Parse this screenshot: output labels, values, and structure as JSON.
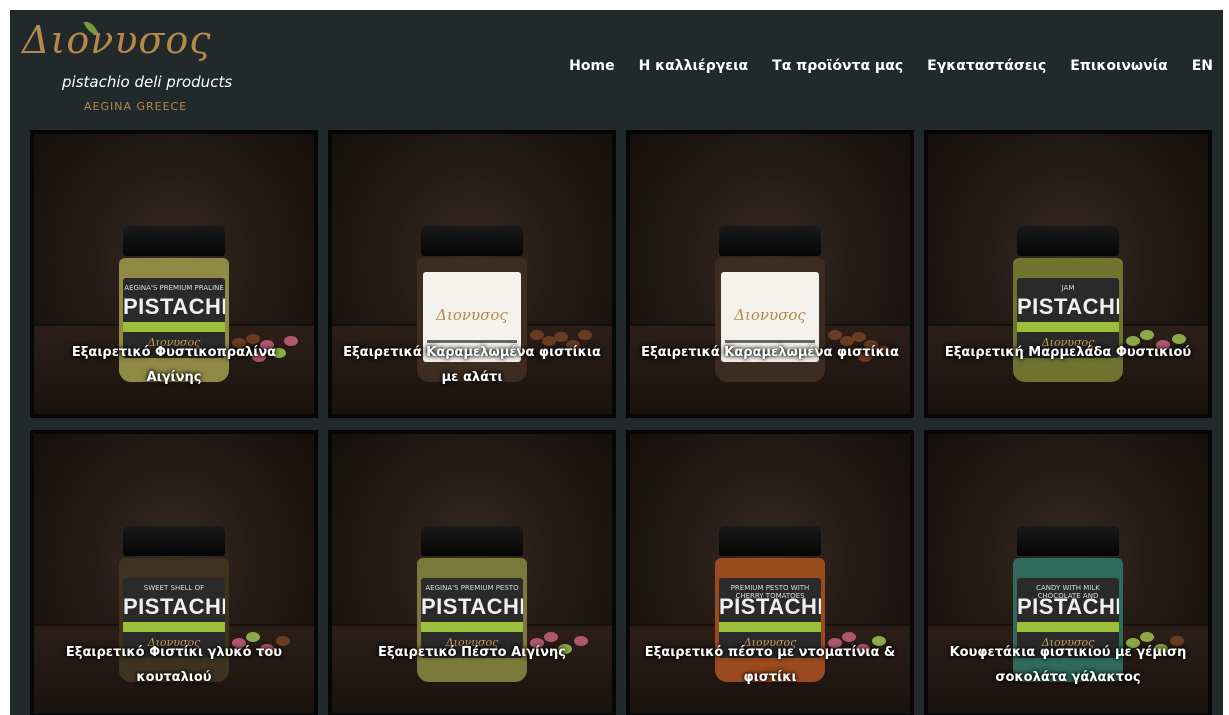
{
  "brand": {
    "name": "Διονυσος",
    "tagline": "pistachio deli products",
    "location": "AEGINA GREECE",
    "colors": {
      "gold": "#b5894a",
      "leaf": "#7a9b3a",
      "background": "#22292a"
    }
  },
  "nav": {
    "items": [
      {
        "label": "Home"
      },
      {
        "label": "Η καλλιέργεια"
      },
      {
        "label": "Τα προϊόντα μας"
      },
      {
        "label": "Εγκαταστάσεις"
      },
      {
        "label": "Επικοινωνία"
      },
      {
        "label": "EN"
      }
    ]
  },
  "products": [
    {
      "caption": "Εξαιρετικό Φυστικοπραλίνα Αιγίνης",
      "jar_style": "dark",
      "glass_color": "#8f8a45",
      "label_top": "AEGINA'S PREMIUM PRALINE",
      "label_main": "PISTACHIO",
      "label_brand": "Διονυσος"
    },
    {
      "caption": "Εξαιρετικά Καραμελωμένα φιστίκια με αλάτι",
      "jar_style": "white",
      "glass_color": "#3d2c22",
      "label_brand": "Διονυσος"
    },
    {
      "caption": "Εξαιρετικά Καραμελωμένα φιστίκια",
      "jar_style": "white",
      "glass_color": "#3d2c22",
      "label_brand": "Διονυσος"
    },
    {
      "caption": "Εξαιρετική Μαρμελάδα Φυστικιού",
      "jar_style": "dark",
      "glass_color": "#6e7330",
      "label_top": "JAM",
      "label_main": "PISTACHIO",
      "label_brand": "Διονυσος"
    },
    {
      "caption": "Εξαιρετικό Φιστίκι γλυκό του κουταλιού",
      "jar_style": "dark",
      "glass_color": "#3f3320",
      "label_top": "SWEET SHELL OF",
      "label_main": "PISTACHIO",
      "label_brand": "Διονυσος"
    },
    {
      "caption": "Εξαιρετικό Πέστο Αιγίνης",
      "jar_style": "dark",
      "glass_color": "#7b7a3a",
      "label_top": "AEGINA'S PREMIUM PESTO",
      "label_main": "PISTACHIO",
      "label_brand": "Διονυσος"
    },
    {
      "caption": "Εξαιρετικό πέστο με ντοματίνια & φιστίκι",
      "jar_style": "dark",
      "glass_color": "#9a4a1e",
      "label_top": "PREMIUM PESTO WITH CHERRY TOMATOES",
      "label_main": "PISTACHIO",
      "label_brand": "Διονυσος"
    },
    {
      "caption": "Κουφετάκια φιστικιού με γέμιση σοκολάτα γάλακτος",
      "jar_style": "dark",
      "glass_color": "#2f6a5a",
      "label_top": "CANDY WITH MILK CHOCOLATE AND",
      "label_main": "PISTACHIO",
      "label_brand": "Διονυσος"
    }
  ]
}
